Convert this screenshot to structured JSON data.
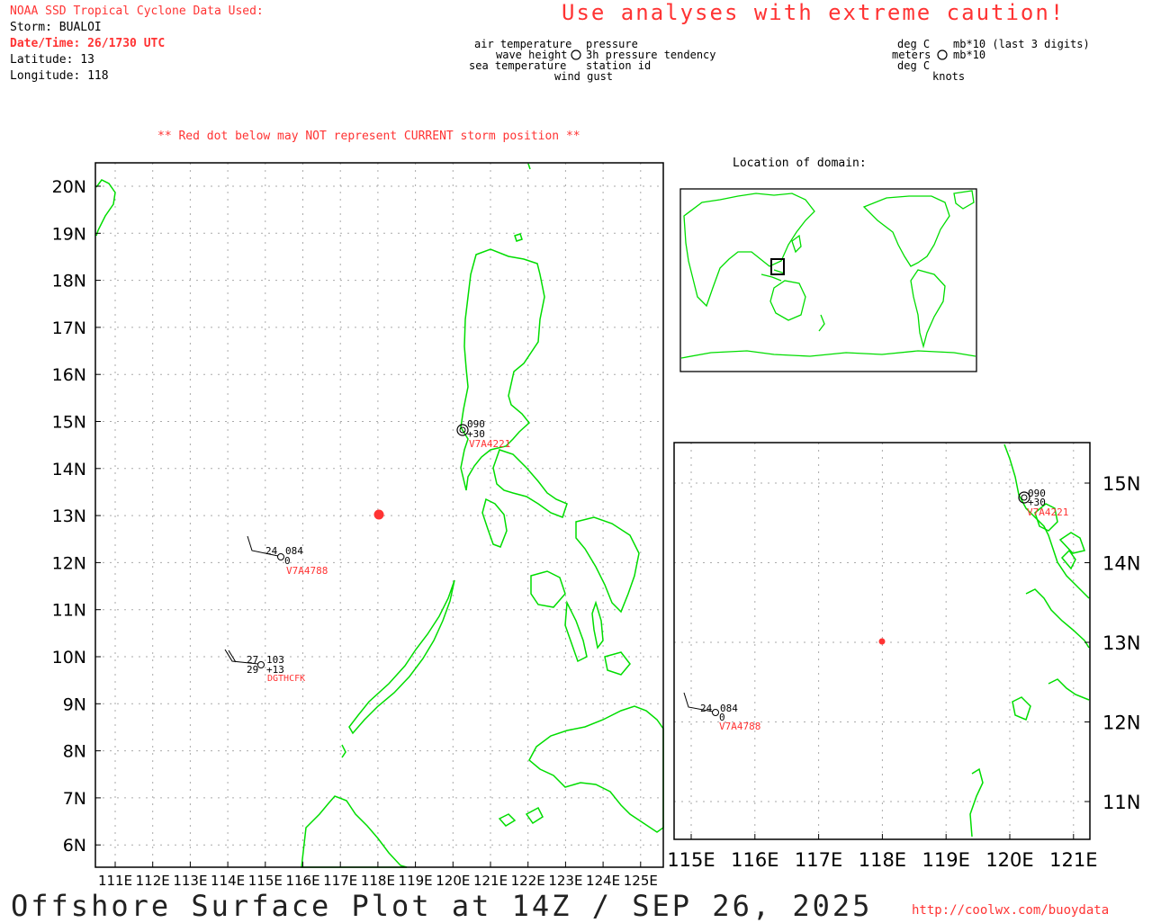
{
  "header": {
    "source": "NOAA SSD Tropical Cyclone Data Used:",
    "storm": "Storm: BUALOI",
    "datetime": "Date/Time: 26/1730 UTC",
    "latitude": "Latitude: 13",
    "longitude": "Longitude: 118",
    "caution": "Use analyses with extreme caution!",
    "red_dot_note": "** Red dot below may NOT represent CURRENT storm position **"
  },
  "legend": {
    "left": {
      "air_temperature": "air temperature",
      "wave_height": "wave height",
      "sea_temperature": "sea temperature",
      "pressure": "pressure",
      "pressure_tendency": "3h pressure tendency",
      "station_id": "station id",
      "wind_gust": "wind gust"
    },
    "right": {
      "deg_c_top": "deg C",
      "meters": "meters",
      "deg_c_bottom": "deg C",
      "mb_last3": "mb*10 (last 3 digits)",
      "mb": "mb*10",
      "knots": "knots"
    }
  },
  "inset": {
    "title": "Location of domain:"
  },
  "main_map": {
    "lat_labels": [
      "20N",
      "19N",
      "18N",
      "17N",
      "16N",
      "15N",
      "14N",
      "13N",
      "12N",
      "11N",
      "10N",
      "9N",
      "8N",
      "7N",
      "6N"
    ],
    "lon_labels": [
      "111E",
      "112E",
      "113E",
      "114E",
      "115E",
      "116E",
      "117E",
      "118E",
      "119E",
      "120E",
      "121E",
      "122E",
      "123E",
      "124E",
      "125E"
    ],
    "storm_position": {
      "lat": 13,
      "lon": 118
    },
    "stations": [
      {
        "id": "V7A4221",
        "pressure": "090",
        "tendency": "+30"
      },
      {
        "id": "V7A4788",
        "air_temp": "24",
        "pressure": "084",
        "sea_temp": "0"
      },
      {
        "id": "DGTHCFK",
        "air_temp": "27",
        "pressure": "103",
        "sea_temp": "29",
        "tendency": "+13"
      }
    ]
  },
  "zoom_map": {
    "lat_labels": [
      "15N",
      "14N",
      "13N",
      "12N",
      "11N"
    ],
    "lon_labels": [
      "115E",
      "116E",
      "117E",
      "118E",
      "119E",
      "120E",
      "121E"
    ],
    "stations": [
      {
        "id": "V7A4221",
        "pressure": "090",
        "tendency": "+30"
      },
      {
        "id": "V7A4788",
        "air_temp": "24",
        "pressure": "084",
        "sea_temp": "0"
      }
    ]
  },
  "footer": {
    "title": "Offshore Surface Plot at 14Z / SEP 26, 2025",
    "url": "http://coolwx.com/buoydata"
  },
  "colors": {
    "coast": "#00dd00",
    "accent": "#ff3333",
    "grid": "#aaaaaa"
  }
}
